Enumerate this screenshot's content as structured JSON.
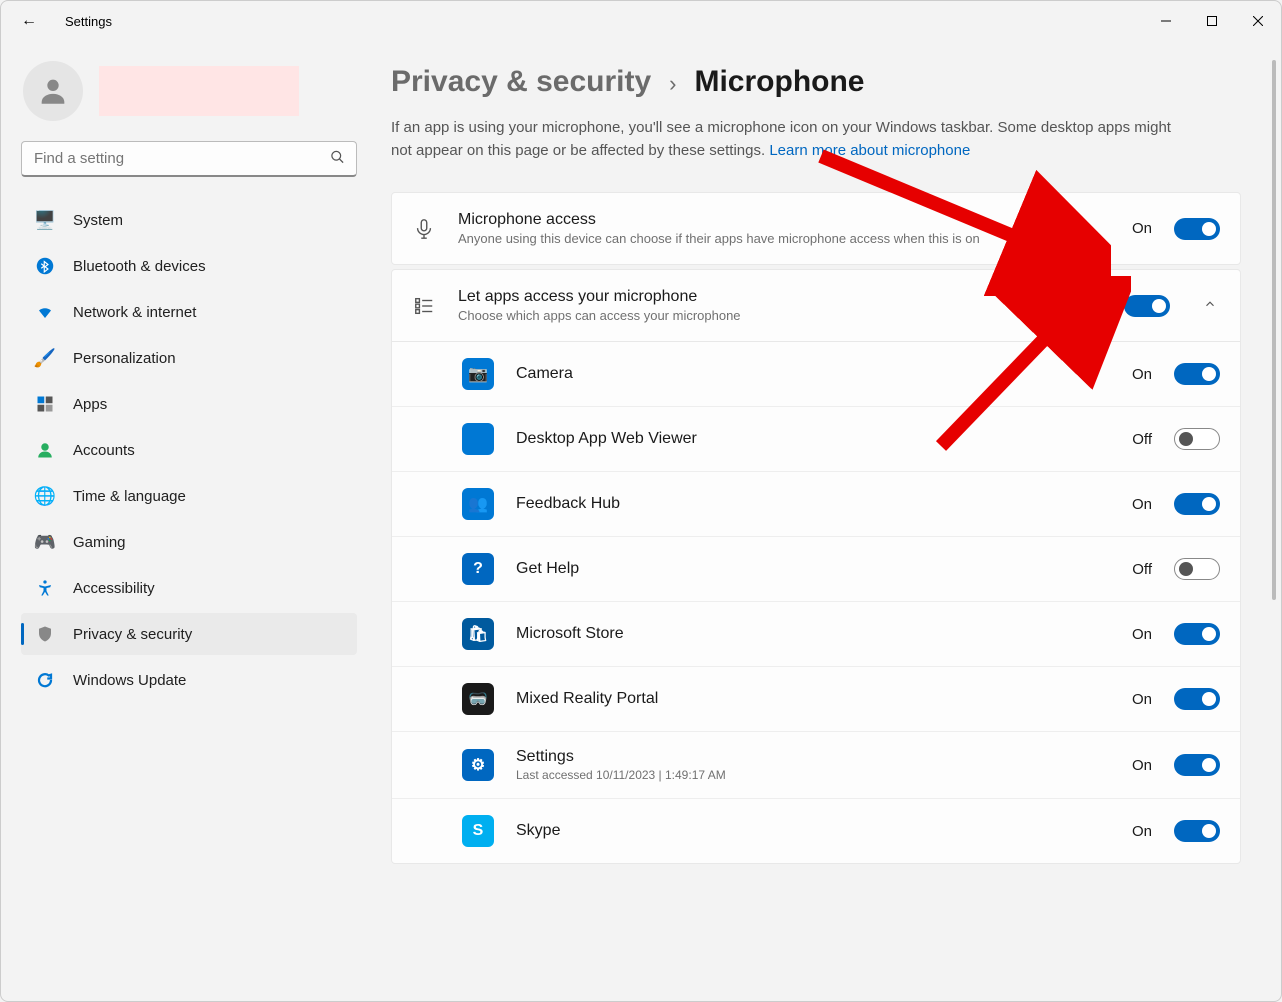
{
  "window": {
    "app_title": "Settings"
  },
  "search": {
    "placeholder": "Find a setting"
  },
  "sidebar": {
    "items": [
      {
        "label": "System"
      },
      {
        "label": "Bluetooth & devices"
      },
      {
        "label": "Network & internet"
      },
      {
        "label": "Personalization"
      },
      {
        "label": "Apps"
      },
      {
        "label": "Accounts"
      },
      {
        "label": "Time & language"
      },
      {
        "label": "Gaming"
      },
      {
        "label": "Accessibility"
      },
      {
        "label": "Privacy & security"
      },
      {
        "label": "Windows Update"
      }
    ]
  },
  "breadcrumb": {
    "parent": "Privacy & security",
    "current": "Microphone"
  },
  "intro": {
    "text": "If an app is using your microphone, you'll see a microphone icon on your Windows taskbar. Some desktop apps might not appear on this page or be affected by these settings.  ",
    "link": "Learn more about microphone"
  },
  "mic_access": {
    "title": "Microphone access",
    "sub": "Anyone using this device can choose if their apps have microphone access when this is on",
    "state_label": "On"
  },
  "let_apps": {
    "title": "Let apps access your microphone",
    "sub": "Choose which apps can access your microphone",
    "state_label": "On"
  },
  "apps": [
    {
      "name": "Camera",
      "state": "On",
      "on": true,
      "bg": "#0078d4",
      "glyph": "📷"
    },
    {
      "name": "Desktop App Web Viewer",
      "state": "Off",
      "on": false,
      "bg": "#0078d4",
      "glyph": ""
    },
    {
      "name": "Feedback Hub",
      "state": "On",
      "on": true,
      "bg": "#0078d4",
      "glyph": "👥"
    },
    {
      "name": "Get Help",
      "state": "Off",
      "on": false,
      "bg": "#0067c0",
      "glyph": "?"
    },
    {
      "name": "Microsoft Store",
      "state": "On",
      "on": true,
      "bg": "#005a9e",
      "glyph": "🛍"
    },
    {
      "name": "Mixed Reality Portal",
      "state": "On",
      "on": true,
      "bg": "#1a1a1a",
      "glyph": "🥽"
    },
    {
      "name": "Settings",
      "sub": "Last accessed 10/11/2023  |  1:49:17 AM",
      "state": "On",
      "on": true,
      "bg": "#0067c0",
      "glyph": "⚙"
    },
    {
      "name": "Skype",
      "state": "On",
      "on": true,
      "bg": "#00aff0",
      "glyph": "S"
    }
  ]
}
